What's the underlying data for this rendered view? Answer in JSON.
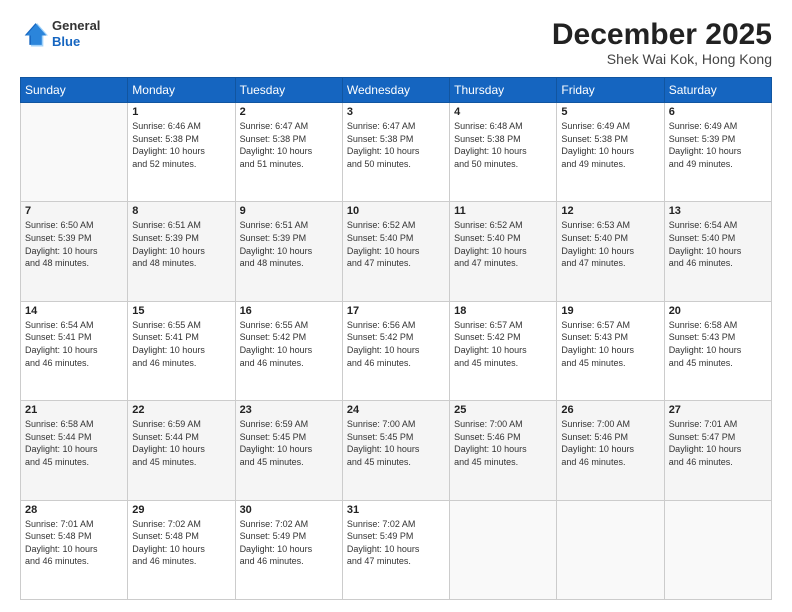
{
  "header": {
    "logo": {
      "general": "General",
      "blue": "Blue"
    },
    "title": "December 2025",
    "location": "Shek Wai Kok, Hong Kong"
  },
  "weekdays": [
    "Sunday",
    "Monday",
    "Tuesday",
    "Wednesday",
    "Thursday",
    "Friday",
    "Saturday"
  ],
  "weeks": [
    [
      {
        "day": "",
        "info": ""
      },
      {
        "day": "1",
        "info": "Sunrise: 6:46 AM\nSunset: 5:38 PM\nDaylight: 10 hours\nand 52 minutes."
      },
      {
        "day": "2",
        "info": "Sunrise: 6:47 AM\nSunset: 5:38 PM\nDaylight: 10 hours\nand 51 minutes."
      },
      {
        "day": "3",
        "info": "Sunrise: 6:47 AM\nSunset: 5:38 PM\nDaylight: 10 hours\nand 50 minutes."
      },
      {
        "day": "4",
        "info": "Sunrise: 6:48 AM\nSunset: 5:38 PM\nDaylight: 10 hours\nand 50 minutes."
      },
      {
        "day": "5",
        "info": "Sunrise: 6:49 AM\nSunset: 5:38 PM\nDaylight: 10 hours\nand 49 minutes."
      },
      {
        "day": "6",
        "info": "Sunrise: 6:49 AM\nSunset: 5:39 PM\nDaylight: 10 hours\nand 49 minutes."
      }
    ],
    [
      {
        "day": "7",
        "info": "Sunrise: 6:50 AM\nSunset: 5:39 PM\nDaylight: 10 hours\nand 48 minutes."
      },
      {
        "day": "8",
        "info": "Sunrise: 6:51 AM\nSunset: 5:39 PM\nDaylight: 10 hours\nand 48 minutes."
      },
      {
        "day": "9",
        "info": "Sunrise: 6:51 AM\nSunset: 5:39 PM\nDaylight: 10 hours\nand 48 minutes."
      },
      {
        "day": "10",
        "info": "Sunrise: 6:52 AM\nSunset: 5:40 PM\nDaylight: 10 hours\nand 47 minutes."
      },
      {
        "day": "11",
        "info": "Sunrise: 6:52 AM\nSunset: 5:40 PM\nDaylight: 10 hours\nand 47 minutes."
      },
      {
        "day": "12",
        "info": "Sunrise: 6:53 AM\nSunset: 5:40 PM\nDaylight: 10 hours\nand 47 minutes."
      },
      {
        "day": "13",
        "info": "Sunrise: 6:54 AM\nSunset: 5:40 PM\nDaylight: 10 hours\nand 46 minutes."
      }
    ],
    [
      {
        "day": "14",
        "info": "Sunrise: 6:54 AM\nSunset: 5:41 PM\nDaylight: 10 hours\nand 46 minutes."
      },
      {
        "day": "15",
        "info": "Sunrise: 6:55 AM\nSunset: 5:41 PM\nDaylight: 10 hours\nand 46 minutes."
      },
      {
        "day": "16",
        "info": "Sunrise: 6:55 AM\nSunset: 5:42 PM\nDaylight: 10 hours\nand 46 minutes."
      },
      {
        "day": "17",
        "info": "Sunrise: 6:56 AM\nSunset: 5:42 PM\nDaylight: 10 hours\nand 46 minutes."
      },
      {
        "day": "18",
        "info": "Sunrise: 6:57 AM\nSunset: 5:42 PM\nDaylight: 10 hours\nand 45 minutes."
      },
      {
        "day": "19",
        "info": "Sunrise: 6:57 AM\nSunset: 5:43 PM\nDaylight: 10 hours\nand 45 minutes."
      },
      {
        "day": "20",
        "info": "Sunrise: 6:58 AM\nSunset: 5:43 PM\nDaylight: 10 hours\nand 45 minutes."
      }
    ],
    [
      {
        "day": "21",
        "info": "Sunrise: 6:58 AM\nSunset: 5:44 PM\nDaylight: 10 hours\nand 45 minutes."
      },
      {
        "day": "22",
        "info": "Sunrise: 6:59 AM\nSunset: 5:44 PM\nDaylight: 10 hours\nand 45 minutes."
      },
      {
        "day": "23",
        "info": "Sunrise: 6:59 AM\nSunset: 5:45 PM\nDaylight: 10 hours\nand 45 minutes."
      },
      {
        "day": "24",
        "info": "Sunrise: 7:00 AM\nSunset: 5:45 PM\nDaylight: 10 hours\nand 45 minutes."
      },
      {
        "day": "25",
        "info": "Sunrise: 7:00 AM\nSunset: 5:46 PM\nDaylight: 10 hours\nand 45 minutes."
      },
      {
        "day": "26",
        "info": "Sunrise: 7:00 AM\nSunset: 5:46 PM\nDaylight: 10 hours\nand 46 minutes."
      },
      {
        "day": "27",
        "info": "Sunrise: 7:01 AM\nSunset: 5:47 PM\nDaylight: 10 hours\nand 46 minutes."
      }
    ],
    [
      {
        "day": "28",
        "info": "Sunrise: 7:01 AM\nSunset: 5:48 PM\nDaylight: 10 hours\nand 46 minutes."
      },
      {
        "day": "29",
        "info": "Sunrise: 7:02 AM\nSunset: 5:48 PM\nDaylight: 10 hours\nand 46 minutes."
      },
      {
        "day": "30",
        "info": "Sunrise: 7:02 AM\nSunset: 5:49 PM\nDaylight: 10 hours\nand 46 minutes."
      },
      {
        "day": "31",
        "info": "Sunrise: 7:02 AM\nSunset: 5:49 PM\nDaylight: 10 hours\nand 47 minutes."
      },
      {
        "day": "",
        "info": ""
      },
      {
        "day": "",
        "info": ""
      },
      {
        "day": "",
        "info": ""
      }
    ]
  ]
}
